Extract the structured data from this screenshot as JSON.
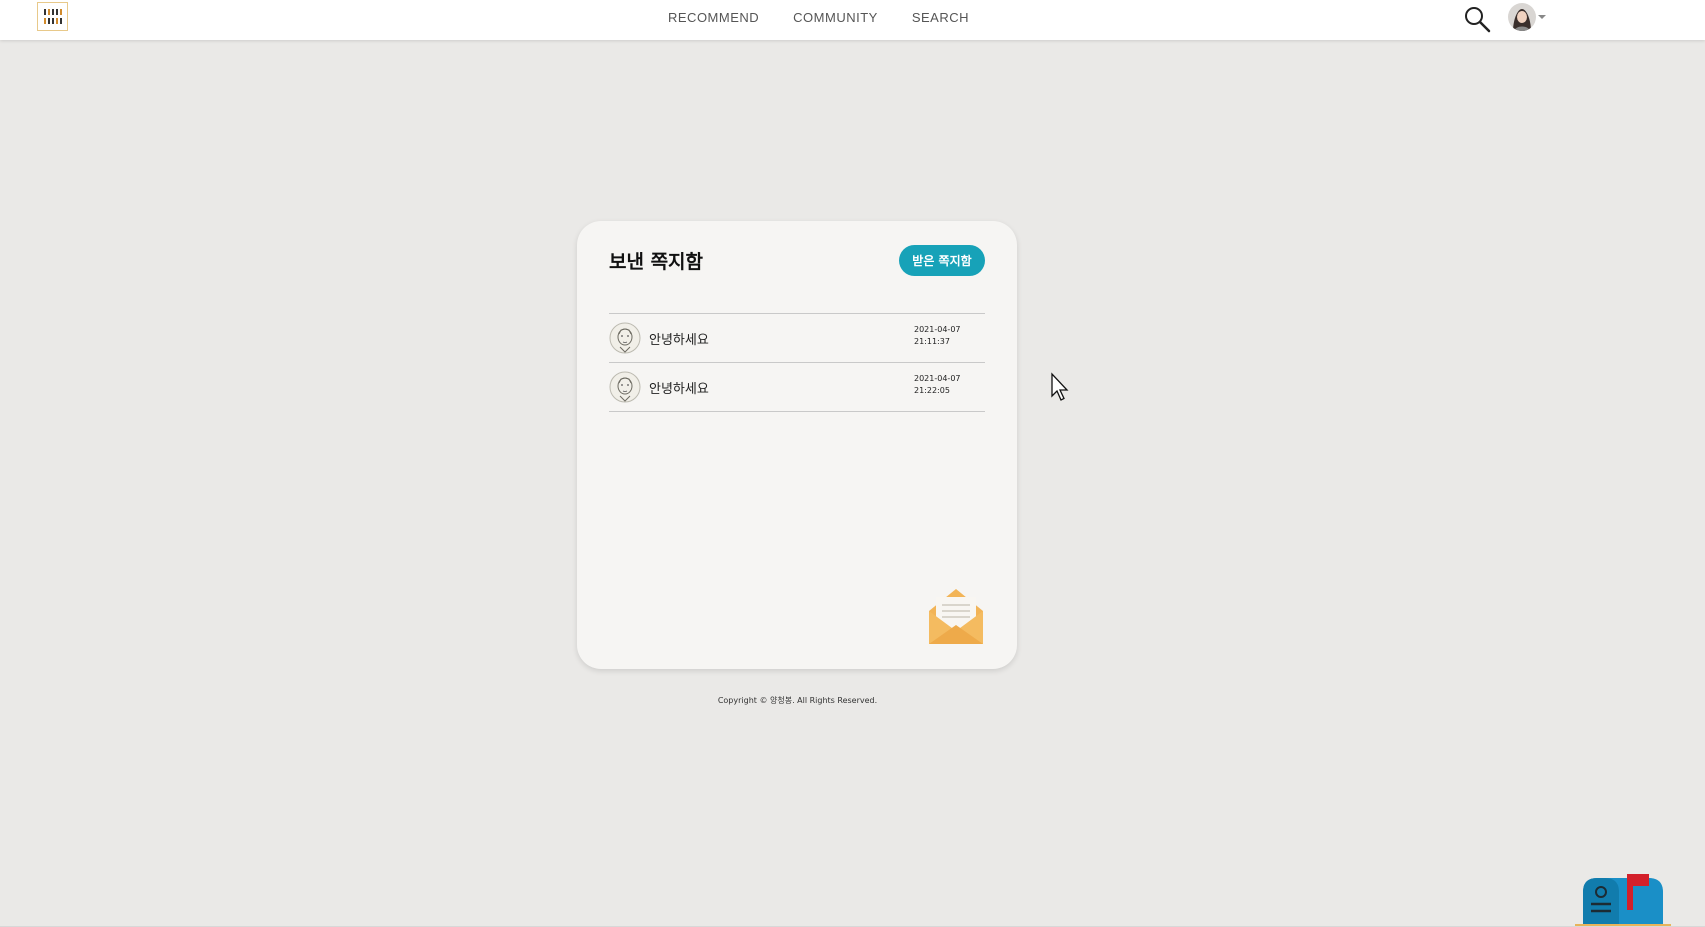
{
  "nav": {
    "links": [
      "RECOMMEND",
      "COMMUNITY",
      "SEARCH"
    ]
  },
  "page": {
    "title": "보낸 쪽지함",
    "received_button": "받은 쪽지함"
  },
  "messages": [
    {
      "subject": "안녕하세요",
      "date": "2021-04-07",
      "time": "21:11:37"
    },
    {
      "subject": "안녕하세요",
      "date": "2021-04-07",
      "time": "21:22:05"
    }
  ],
  "footer": {
    "copyright": "Copyright © 양청봉. All Rights Reserved."
  },
  "colors": {
    "accent": "#17a2b8",
    "background": "#eae9e7",
    "card": "#f6f5f3",
    "envelope": "#f2b457"
  },
  "icons": [
    "logo-icon",
    "search-icon",
    "avatar",
    "envelope-icon",
    "mailbox-icon",
    "mouse-cursor"
  ]
}
